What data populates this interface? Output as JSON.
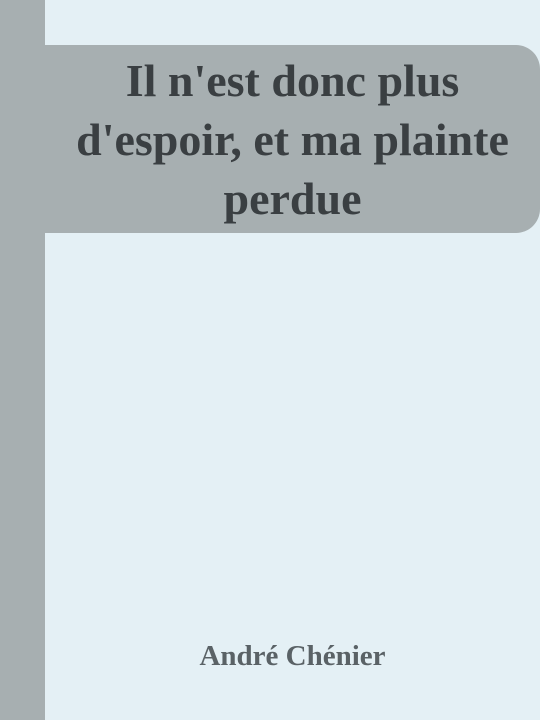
{
  "book": {
    "title": "Il n'est donc plus d'espoir, et ma plainte perdue",
    "author": "André Chénier"
  },
  "colors": {
    "background": "#e4f0f5",
    "band": "#a7afb1",
    "title_text": "#3a3f42",
    "author_text": "#5a6266"
  }
}
